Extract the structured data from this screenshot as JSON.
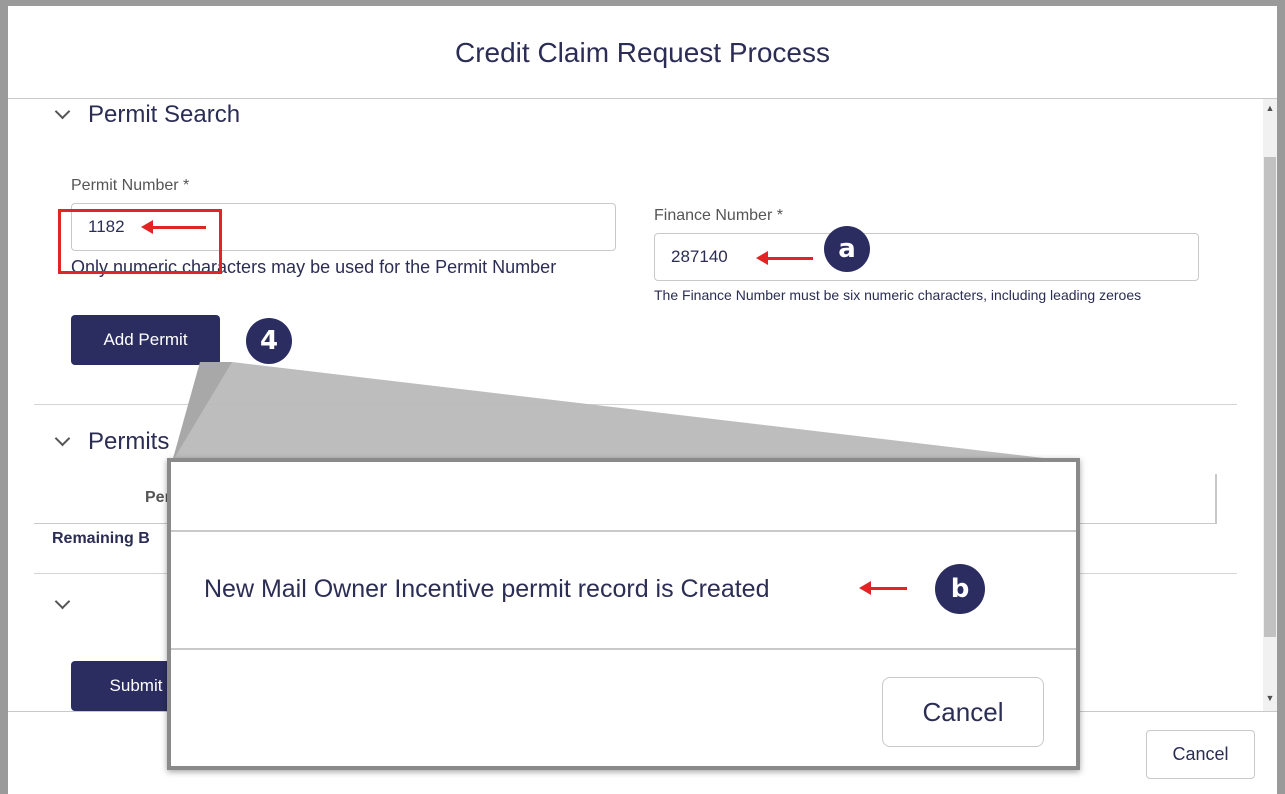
{
  "dialog": {
    "title": "Credit Claim Request Process"
  },
  "permit_search": {
    "section_title": "Permit Search",
    "permit_number": {
      "label": "Permit Number *",
      "value": "1182",
      "help": "Only numeric characters may be used for the Permit Number"
    },
    "finance_number": {
      "label": "Finance Number *",
      "value": "287140",
      "help": "The Finance Number must be six numeric characters, including leading zeroes"
    },
    "add_permit_label": "Add Permit"
  },
  "permits_section": {
    "title": "Permits",
    "column_fragment": "Per",
    "remaining_fragment": "Remaining B"
  },
  "submit_label": "Submit",
  "footer": {
    "cancel_label": "Cancel"
  },
  "zoom_modal": {
    "message": "New Mail Owner Incentive permit record is Created",
    "cancel_label": "Cancel"
  },
  "callouts": {
    "step": "4",
    "a": "a",
    "b": "b"
  },
  "colors": {
    "navy": "#2b2d60",
    "annotation_red": "#e32424"
  }
}
